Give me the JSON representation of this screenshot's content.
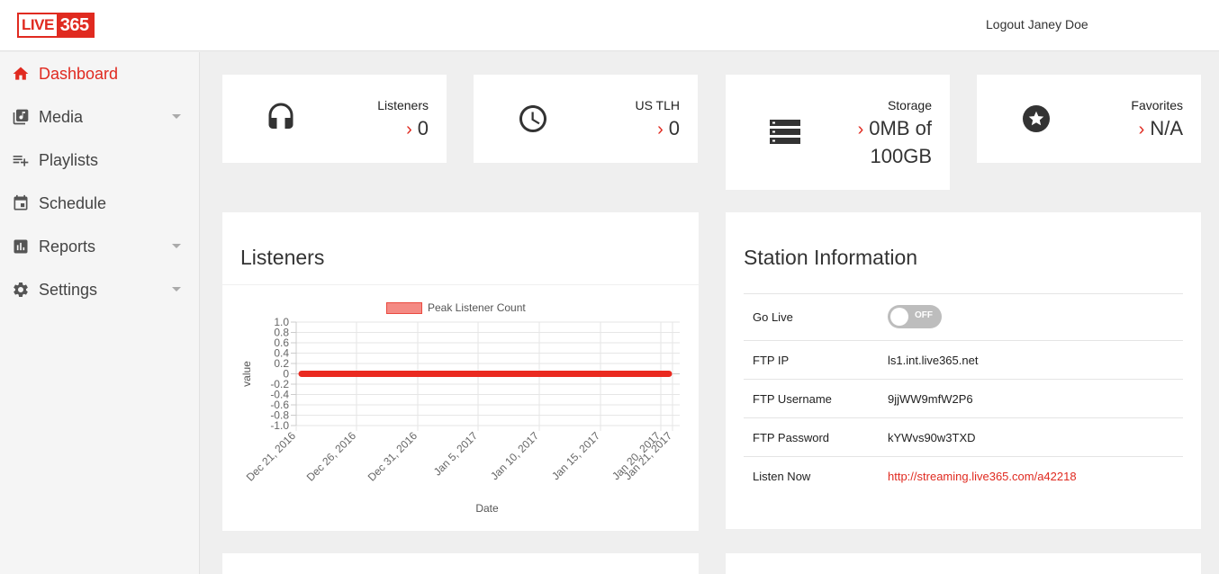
{
  "header": {
    "logo_live": "LIVE",
    "logo_num": "365",
    "logout": "Logout",
    "user_name": "Janey Doe"
  },
  "sidebar": {
    "items": [
      {
        "label": "Dashboard",
        "icon": "home-icon"
      },
      {
        "label": "Media",
        "icon": "media-library-icon"
      },
      {
        "label": "Playlists",
        "icon": "playlist-add-icon"
      },
      {
        "label": "Schedule",
        "icon": "calendar-icon"
      },
      {
        "label": "Reports",
        "icon": "bar-chart-icon"
      },
      {
        "label": "Settings",
        "icon": "gear-icon"
      }
    ]
  },
  "stats": {
    "listeners": {
      "label": "Listeners",
      "value": "0",
      "icon": "headphones-icon"
    },
    "tlh": {
      "label": "US TLH",
      "value": "0",
      "icon": "clock-icon"
    },
    "storage": {
      "label": "Storage",
      "value_line1": "0MB of",
      "value_line2": "100GB",
      "icon": "storage-icon"
    },
    "favorites": {
      "label": "Favorites",
      "value": "N/A",
      "icon": "star-icon"
    },
    "arrow": "›"
  },
  "listeners_panel": {
    "title": "Listeners"
  },
  "chart_data": {
    "type": "line",
    "title": "",
    "xlabel": "Date",
    "ylabel": "value",
    "ylim": [
      -1.0,
      1.0
    ],
    "y_ticks": [
      "1.0",
      "0.8",
      "0.6",
      "0.4",
      "0.2",
      "0",
      "-0.2",
      "-0.4",
      "-0.6",
      "-0.8",
      "-1.0"
    ],
    "x_ticks": [
      "Dec 21, 2016",
      "Dec 26, 2016",
      "Dec 31, 2016",
      "Jan 5, 2017",
      "Jan 10, 2017",
      "Jan 15, 2017",
      "Jan 20, 2017",
      "Jan 21, 2017"
    ],
    "legend_placement": "top",
    "grid": true,
    "series": [
      {
        "name": "Peak Listener Count",
        "color": "#ea2a20",
        "x_start": "Dec 21, 2016",
        "x_end": "Jan 21, 2017",
        "values": [
          0,
          0
        ]
      }
    ]
  },
  "station": {
    "title": "Station Information",
    "rows": [
      {
        "key": "Go Live",
        "toggle": "OFF"
      },
      {
        "key": "FTP IP",
        "value": "ls1.int.live365.net"
      },
      {
        "key": "FTP Username",
        "value": "9jjWW9mfW2P6"
      },
      {
        "key": "FTP Password",
        "value": "kYWvs90w3TXD"
      },
      {
        "key": "Listen Now",
        "value": "http://streaming.live365.com/a42218"
      }
    ]
  },
  "colors": {
    "accent": "#e02a20",
    "background": "#efefef"
  }
}
